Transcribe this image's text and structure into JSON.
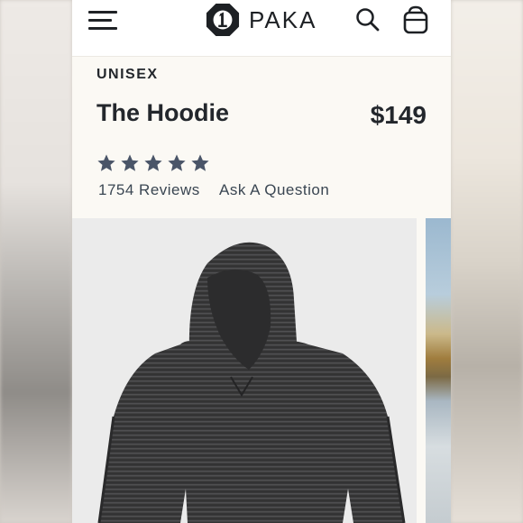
{
  "header": {
    "brand": "PAKA",
    "icons": [
      "menu-icon",
      "paka-logo",
      "search-icon",
      "shopping-bag-icon"
    ]
  },
  "product": {
    "gender": "UNISEX",
    "title": "The Hoodie",
    "price": "$149",
    "rating": 5,
    "reviews": "1754 Reviews",
    "ask": "Ask A Question"
  },
  "colors": {
    "text": "#23272c",
    "star": "#4a5568",
    "link": "#3a4652",
    "panel": "#fbf9f4",
    "image_bg": "#ebebeb",
    "hoodie": "#3b3b3c"
  }
}
